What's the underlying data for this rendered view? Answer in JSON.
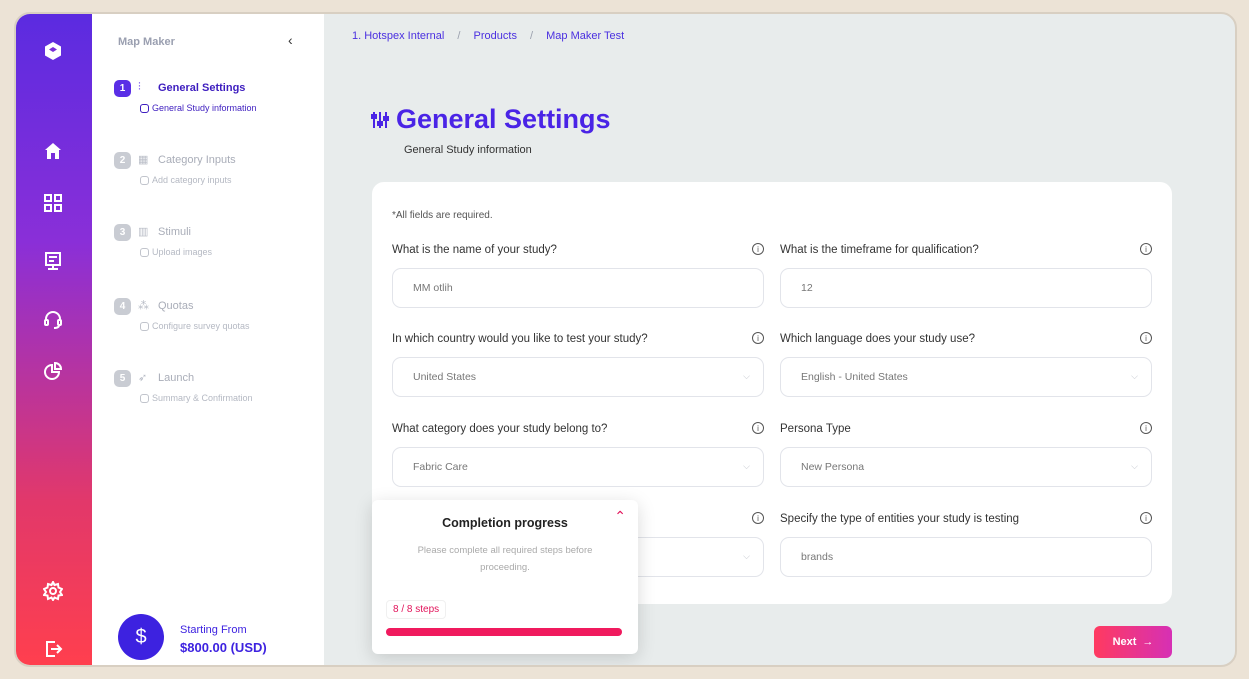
{
  "sidebar": {
    "app_name": "Map Maker",
    "collapse_glyph": "‹",
    "steps": [
      {
        "number": "1",
        "title": "General Settings",
        "sub": "General Study information",
        "icon": "sliders-icon"
      },
      {
        "number": "2",
        "title": "Category Inputs",
        "sub": "Add category inputs",
        "icon": "grid-icon"
      },
      {
        "number": "3",
        "title": "Stimuli",
        "sub": "Upload images",
        "icon": "image-chart-icon"
      },
      {
        "number": "4",
        "title": "Quotas",
        "sub": "Configure survey quotas",
        "icon": "hierarchy-icon"
      },
      {
        "number": "5",
        "title": "Launch",
        "sub": "Summary & Confirmation",
        "icon": "rocket-icon"
      }
    ],
    "price": {
      "label": "Starting From",
      "amount": "$800.00 (USD)",
      "symbol": "$"
    }
  },
  "breadcrumb": {
    "items": [
      "1. Hotspex Internal",
      "Products",
      "Map Maker Test"
    ],
    "separator": "/"
  },
  "page": {
    "title": "General Settings",
    "subtitle": "General Study information"
  },
  "form": {
    "required_note": "*All fields are required.",
    "fields": {
      "study_name": {
        "label": "What is the name of your study?",
        "value": "MM otlih"
      },
      "timeframe": {
        "label": "What is the timeframe for qualification?",
        "value": "12"
      },
      "country": {
        "label": "In which country would you like to test your study?",
        "value": "United States"
      },
      "language": {
        "label": "Which language does your study use?",
        "value": "English - United States"
      },
      "category": {
        "label": "What category does your study belong to?",
        "value": "Fabric Care"
      },
      "persona": {
        "label": "Persona Type",
        "value": "New Persona"
      },
      "entities": {
        "label": "Specify the type of entities your study is testing",
        "value": "brands"
      }
    }
  },
  "progress": {
    "title": "Completion progress",
    "description": "Please complete all required steps before proceeding.",
    "count": "8 / 8 steps",
    "fraction": 1.0
  },
  "actions": {
    "next_label": "Next",
    "next_arrow": "→"
  },
  "colors": {
    "accent": "#4a24e6",
    "progress": "#f01a5e"
  }
}
